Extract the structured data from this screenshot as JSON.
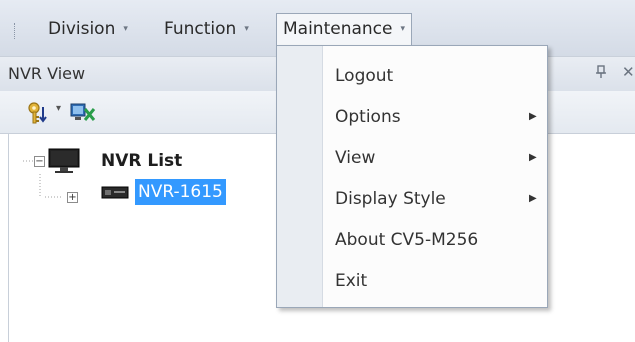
{
  "menubar": {
    "items": [
      {
        "label": "Division",
        "arrow": "▾"
      },
      {
        "label": "Function",
        "arrow": "▾"
      },
      {
        "label": "Maintenance",
        "arrow": "▾"
      }
    ]
  },
  "panel": {
    "title": "NVR View",
    "pin_icon": "pin-icon",
    "close_label": "✕"
  },
  "toolbar": {
    "key_dropdown_arrow": "▾",
    "icons": [
      "key-sort-icon",
      "monitor-disconnect-icon"
    ]
  },
  "tree": {
    "root": {
      "label": "NVR List",
      "expander": "−"
    },
    "child": {
      "label": "NVR-1615",
      "expander": "+"
    }
  },
  "dropdown": {
    "items": [
      {
        "label": "Logout",
        "has_submenu": false
      },
      {
        "label": "Options",
        "has_submenu": true
      },
      {
        "label": "View",
        "has_submenu": true
      },
      {
        "label": "Display Style",
        "has_submenu": true
      },
      {
        "label": "About CV5-M256",
        "has_submenu": false
      },
      {
        "label": "Exit",
        "has_submenu": false
      }
    ],
    "submenu_arrow": "▶"
  },
  "colors": {
    "selection": "#3399ff",
    "menubar": "#dbe1ea"
  }
}
